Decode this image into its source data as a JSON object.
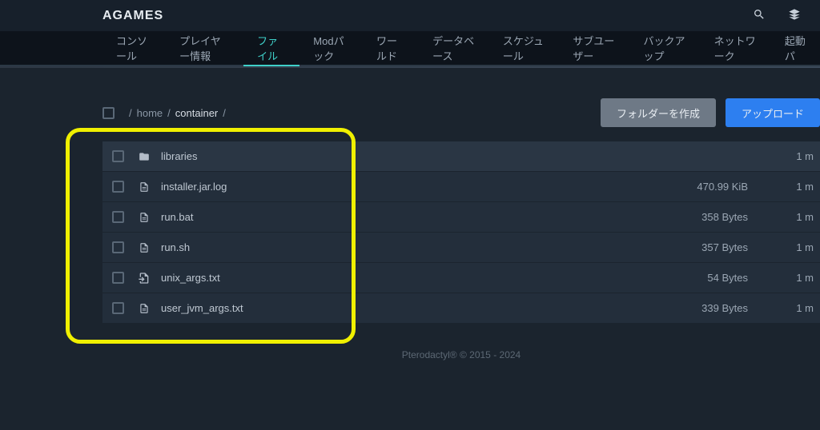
{
  "header": {
    "brand": "AGAMES"
  },
  "nav": {
    "items": [
      {
        "label": "コンソール",
        "active": false
      },
      {
        "label": "プレイヤー情報",
        "active": false
      },
      {
        "label": "ファイル",
        "active": true
      },
      {
        "label": "Modパック",
        "active": false
      },
      {
        "label": "ワールド",
        "active": false
      },
      {
        "label": "データベース",
        "active": false
      },
      {
        "label": "スケジュール",
        "active": false
      },
      {
        "label": "サブユーザー",
        "active": false
      },
      {
        "label": "バックアップ",
        "active": false
      },
      {
        "label": "ネットワーク",
        "active": false
      },
      {
        "label": "起動パ",
        "active": false
      }
    ]
  },
  "breadcrumb": {
    "sep1": "/",
    "home": "home",
    "sep2": "/",
    "container": "container",
    "sep3": "/"
  },
  "buttons": {
    "create_folder": "フォルダーを作成",
    "upload": "アップロード"
  },
  "files": [
    {
      "icon": "folder",
      "name": "libraries",
      "size": "",
      "time": "1 m",
      "alt": true
    },
    {
      "icon": "file",
      "name": "installer.jar.log",
      "size": "470.99 KiB",
      "time": "1 m",
      "alt": false
    },
    {
      "icon": "file",
      "name": "run.bat",
      "size": "358 Bytes",
      "time": "1 m",
      "alt": false
    },
    {
      "icon": "file",
      "name": "run.sh",
      "size": "357 Bytes",
      "time": "1 m",
      "alt": false
    },
    {
      "icon": "file-import",
      "name": "unix_args.txt",
      "size": "54 Bytes",
      "time": "1 m",
      "alt": false
    },
    {
      "icon": "file",
      "name": "user_jvm_args.txt",
      "size": "339 Bytes",
      "time": "1 m",
      "alt": false
    }
  ],
  "footer": {
    "text": "Pterodactyl® © 2015 - 2024"
  }
}
